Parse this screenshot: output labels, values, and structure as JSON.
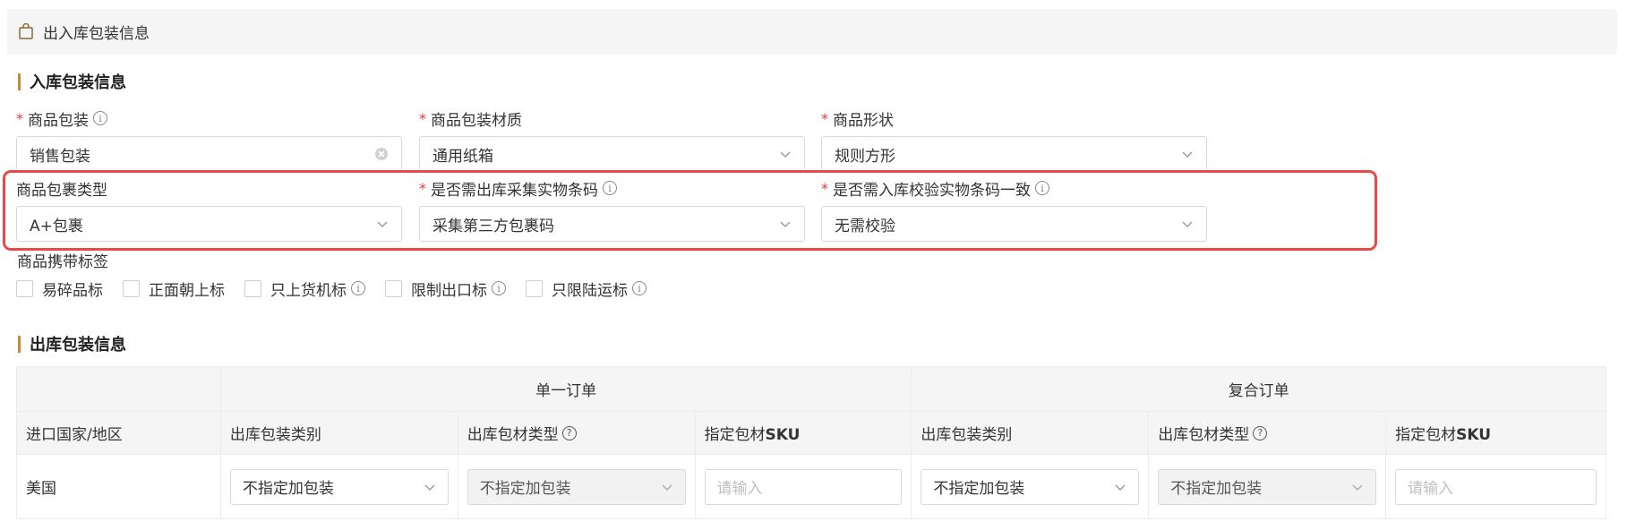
{
  "header": {
    "title": "出入库包装信息",
    "icon": "shopping-bag-icon"
  },
  "inbound": {
    "section_title": "入库包装信息",
    "fields": {
      "packaging": {
        "label": "商品包装",
        "value": "销售包装",
        "required": "*"
      },
      "material": {
        "label": "商品包装材质",
        "value": "通用纸箱",
        "required": "*"
      },
      "shape": {
        "label": "商品形状",
        "value": "规则方形",
        "required": "*"
      },
      "parcel_type": {
        "label": "商品包裹类型",
        "value": "A+包裹"
      },
      "collect_barcode": {
        "label": "是否需出库采集实物条码",
        "value": "采集第三方包裹码",
        "required": "*"
      },
      "verify_barcode": {
        "label": "是否需入库校验实物条码一致",
        "value": "无需校验",
        "required": "*"
      }
    },
    "tags_label": "商品携带标签",
    "tags": [
      "易碎品标",
      "正面朝上标",
      "只上货机标",
      "限制出口标",
      "只限陆运标"
    ]
  },
  "outbound": {
    "section_title": "出库包装信息",
    "groups": {
      "single": "单一订单",
      "combined": "复合订单"
    },
    "columns": {
      "country": "进口国家/地区",
      "pack_category": "出库包装类别",
      "material_type": "出库包材类型",
      "sku_prefix": "指定包材",
      "sku_suffix": "SKU"
    },
    "rows": [
      {
        "country": "美国",
        "single_category": "不指定加包装",
        "single_material": "不指定加包装",
        "single_sku_placeholder": "请输入",
        "combined_category": "不指定加包装",
        "combined_material": "不指定加包装",
        "combined_sku_placeholder": "请输入"
      }
    ]
  },
  "colors": {
    "accent": "#c8893a",
    "highlight": "#e84a4a",
    "required": "#e03c3c"
  }
}
